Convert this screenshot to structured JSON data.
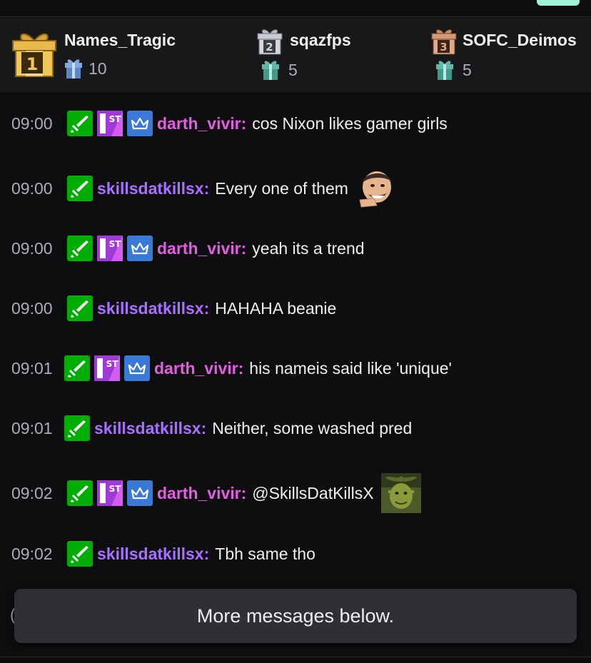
{
  "leaderboard": {
    "gifters": [
      {
        "rank": "1",
        "name": "Names_Tragic",
        "count": "10"
      },
      {
        "rank": "2",
        "name": "sqazfps",
        "count": "5"
      },
      {
        "rank": "3",
        "name": "SOFC_Deimos",
        "count": "5"
      }
    ]
  },
  "chat": {
    "messages": [
      {
        "time": "09:00",
        "user": "darth_vivir",
        "text": "cos Nixon likes gamer girls"
      },
      {
        "time": "09:00",
        "user": "skillsdatkillsx",
        "text": "Every one of them"
      },
      {
        "time": "09:00",
        "user": "darth_vivir",
        "text": "yeah its a trend"
      },
      {
        "time": "09:00",
        "user": "skillsdatkillsx",
        "text": "HAHAHA beanie"
      },
      {
        "time": "09:01",
        "user": "darth_vivir",
        "text": "his nameis said like 'unique'"
      },
      {
        "time": "09:01",
        "user": "skillsdatkillsx",
        "text": "Neither, some washed pred"
      },
      {
        "time": "09:02",
        "user": "darth_vivir",
        "text": "@SkillsDatKillsX"
      },
      {
        "time": "09:02",
        "user": "skillsdatkillsx",
        "text": "Tbh same tho"
      }
    ],
    "colon": ":",
    "badge_first_label": "ST",
    "badge_first_num": "1"
  },
  "toast": {
    "label": "More messages below."
  },
  "partial_line": "("
}
